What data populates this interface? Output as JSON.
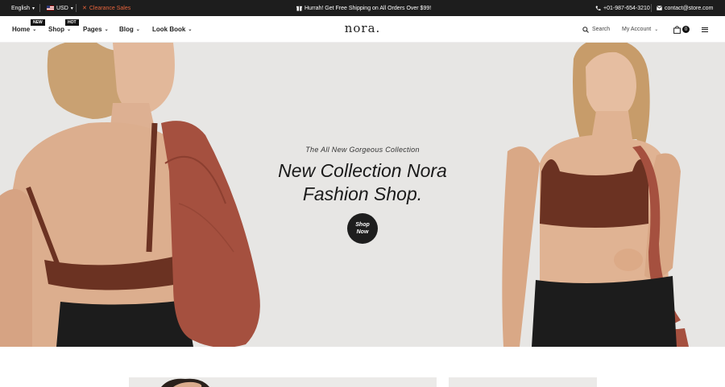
{
  "topbar": {
    "language": "English",
    "currency": "USD",
    "clearance": "Clearance Sales",
    "promo": "Hurrah! Get Free Shipping on All Orders Over $99!",
    "phone": "+01-987-654-3210",
    "email": "contact@store.com"
  },
  "header": {
    "logo": "nora.",
    "nav": [
      {
        "label": "Home",
        "badge": "NEW"
      },
      {
        "label": "Shop",
        "badge": "HOT"
      },
      {
        "label": "Pages",
        "badge": ""
      },
      {
        "label": "Blog",
        "badge": ""
      },
      {
        "label": "Look Book",
        "badge": ""
      }
    ],
    "search_label": "Search",
    "account_label": "My Account",
    "cart_count": "0"
  },
  "hero": {
    "tagline": "The All New Gorgeous Collection",
    "headline_line1": "New Collection Nora",
    "headline_line2": "Fashion Shop.",
    "button_line1": "Shop",
    "button_line2": "Now"
  },
  "colors": {
    "topbar_bg": "#1d1d1d",
    "accent": "#e8643c",
    "hero_bg": "#e7e6e4",
    "brown": "#6b3222",
    "bag": "#a5503f"
  },
  "icons": [
    "flag-us-icon",
    "percent-icon",
    "gift-icon",
    "phone-icon",
    "mail-icon",
    "search-icon",
    "cart-icon",
    "menu-icon",
    "chevron-down-icon"
  ]
}
